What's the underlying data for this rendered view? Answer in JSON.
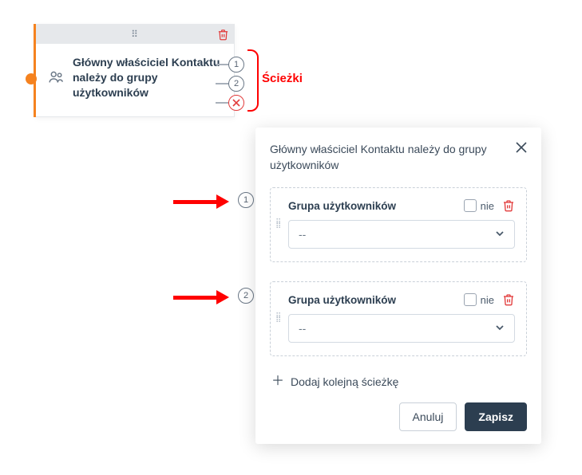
{
  "node": {
    "title": "Główny właściciel Kontaktu należy do grupy użytkowników"
  },
  "annotation": {
    "paths_label": "Ścieżki"
  },
  "panel": {
    "title": "Główny właściciel Kontaktu należy do grupy użytkowników",
    "paths": [
      {
        "label": "Grupa użytkowników",
        "negate_label": "nie",
        "select_value": "--"
      },
      {
        "label": "Grupa użytkowników",
        "negate_label": "nie",
        "select_value": "--"
      }
    ],
    "add_path_label": "Dodaj kolejną ścieżkę",
    "cancel_label": "Anuluj",
    "save_label": "Zapisz"
  },
  "path_numbers": {
    "p1": "1",
    "p2": "2"
  },
  "colors": {
    "orange": "#f5821f",
    "red": "#ff0000",
    "danger": "#e23b3b",
    "primary_dark": "#2c3e50"
  }
}
